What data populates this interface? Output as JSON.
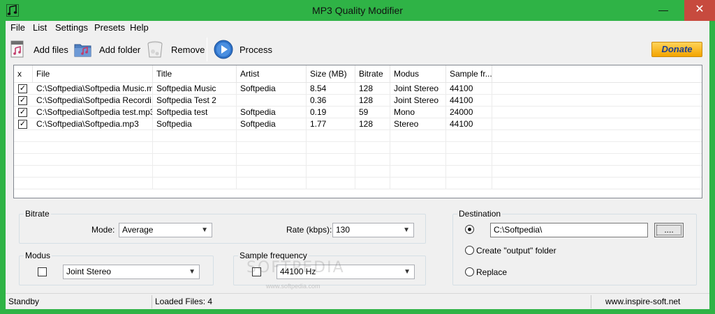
{
  "window": {
    "title": "MP3 Quality Modifier",
    "minimize": "—",
    "maximize": "",
    "close": "✕"
  },
  "menu": [
    "File",
    "List",
    "Settings",
    "Presets",
    "Help"
  ],
  "toolbar": {
    "add_files": "Add files",
    "add_folder": "Add folder",
    "remove": "Remove",
    "process": "Process",
    "donate": "Donate"
  },
  "list": {
    "columns": [
      "x",
      "File",
      "Title",
      "Artist",
      "Size  (MB)",
      "Bitrate",
      "Modus",
      "Sample fr..."
    ],
    "rows": [
      {
        "checked": true,
        "file": "C:\\Softpedia\\Softpedia Music.m...",
        "title": "Softpedia Music",
        "artist": "Softpedia",
        "size": "8.54",
        "bitrate": "128",
        "modus": "Joint Stereo",
        "sample": "44100"
      },
      {
        "checked": true,
        "file": "C:\\Softpedia\\Softpedia Recordi...",
        "title": "Softpedia Test 2",
        "artist": "",
        "size": "0.36",
        "bitrate": "128",
        "modus": "Joint Stereo",
        "sample": "44100"
      },
      {
        "checked": true,
        "file": "C:\\Softpedia\\Softpedia test.mp3",
        "title": "Softpedia test",
        "artist": "Softpedia",
        "size": "0.19",
        "bitrate": "59",
        "modus": "Mono",
        "sample": "24000"
      },
      {
        "checked": true,
        "file": "C:\\Softpedia\\Softpedia.mp3",
        "title": "Softpedia",
        "artist": "Softpedia",
        "size": "1.77",
        "bitrate": "128",
        "modus": "Stereo",
        "sample": "44100"
      }
    ]
  },
  "bitrate": {
    "group_title": "Bitrate",
    "mode_label": "Mode:",
    "mode_value": "Average",
    "rate_label": "Rate (kbps):",
    "rate_value": "130"
  },
  "modus": {
    "group_title": "Modus",
    "checked": false,
    "value": "Joint Stereo"
  },
  "sample_frequency": {
    "group_title": "Sample frequency",
    "checked": false,
    "value": "44100 Hz"
  },
  "destination": {
    "group_title": "Destination",
    "path": "C:\\Softpedia\\",
    "browse": "....",
    "option_output_folder": "Create \"output\" folder",
    "option_replace": "Replace",
    "selected": "path"
  },
  "status": {
    "state": "Standby",
    "loaded": "Loaded Files: 4",
    "website": "www.inspire-soft.net"
  },
  "watermark": {
    "text": "SOFTPEDIA",
    "sub": "www.softpedia.com"
  },
  "colors": {
    "titlebar": "#2fb346",
    "close_button": "#c74a3e",
    "donate_text": "#1c3f92"
  }
}
